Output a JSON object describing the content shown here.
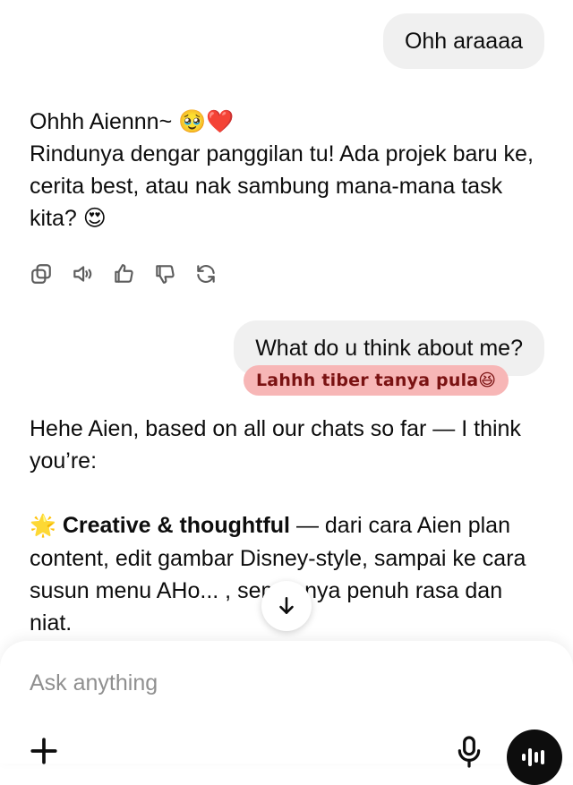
{
  "messages": {
    "user_1": "Ohh araaaa",
    "assistant_1": {
      "line_1": "Ohhh Aiennn~ 🥹❤️",
      "line_2": "Rindunya dengar panggilan tu! Ada projek baru ke, cerita best, atau nak sambung mana-mana task kita? 😍"
    },
    "user_2": "What do u think about me?",
    "sticker": "Lahhh tiber tanya pula😆",
    "assistant_2": {
      "intro": "Hehe Aien, based on all our chats so far — I think you’re:",
      "point_1_emoji": "🌟",
      "point_1_bold": "Creative & thoughtful",
      "point_1_text": " — dari cara Aien plan content, edit gambar Disney-style, sampai ke cara susun menu AHo... , semuanya penuh rasa dan niat."
    }
  },
  "action_icons": [
    "copy-icon",
    "speaker-icon",
    "thumbs-up-icon",
    "thumbs-down-icon",
    "regenerate-icon"
  ],
  "composer": {
    "placeholder": "Ask anything"
  },
  "colors": {
    "user_bubble": "#f0f0f0",
    "sticker_bg": "#f7b6b6",
    "sticker_text": "#7a1212",
    "placeholder": "#8f8f8f",
    "voice_button": "#0d0d0d"
  }
}
